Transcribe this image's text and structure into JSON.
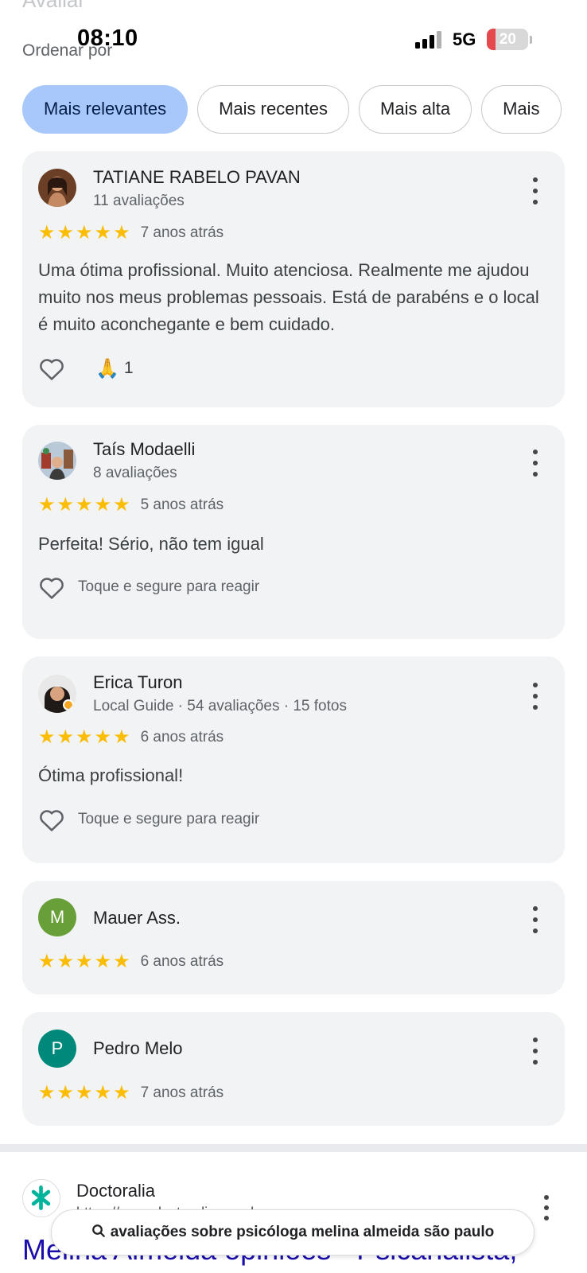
{
  "status_bar": {
    "time": "08:10",
    "network": "5G",
    "battery": "20",
    "battery_level": 0.2
  },
  "header": {
    "section_title": "Avaliar",
    "sort_label": "Ordenar por"
  },
  "sort_chips": [
    {
      "label": "Mais relevantes",
      "selected": true
    },
    {
      "label": "Mais recentes",
      "selected": false
    },
    {
      "label": "Mais alta",
      "selected": false
    },
    {
      "label": "Mais",
      "selected": false
    }
  ],
  "reviews": [
    {
      "name": "TATIANE RABELO PAVAN",
      "meta": "11 avaliações",
      "stars": 5,
      "time": "7 anos atrás",
      "text": "Uma ótima profissional. Muito atenciosa. Realmente me ajudou muito nos meus problemas pessoais. Está de parabéns e o local é muito aconchegante e bem cuidado.",
      "reaction_emoji": "🙏",
      "reaction_count": "1"
    },
    {
      "name": "Taís Modaelli",
      "meta": "8 avaliações",
      "stars": 5,
      "time": "5 anos atrás",
      "text": "Perfeita! Sério, não tem igual",
      "react_hint": "Toque e segure para reagir"
    },
    {
      "name": "Erica Turon",
      "meta": "Local Guide · 54 avaliações · 15 fotos",
      "stars": 5,
      "time": "6 anos atrás",
      "text": "Ótima profissional!",
      "react_hint": "Toque e segure para reagir"
    },
    {
      "name": "Mauer Ass.",
      "initial": "M",
      "avatar_color": "#689f38",
      "stars": 5,
      "time": "6 anos atrás"
    },
    {
      "name": "Pedro Melo",
      "initial": "P",
      "avatar_color": "#00897b",
      "stars": 5,
      "time": "7 anos atrás"
    }
  ],
  "web_result": {
    "site_name": "Doctoralia",
    "url": "https://www.doctoralia.com.br",
    "title": "Melina Almeida opiniões - Psicanalista,"
  },
  "search_query": "avaliações sobre psicóloga melina almeida são paulo",
  "colors": {
    "chip_active": "#a8c7fa",
    "star": "#fbbc04",
    "card_bg": "#f1f3f4",
    "link": "#1a0dab"
  }
}
